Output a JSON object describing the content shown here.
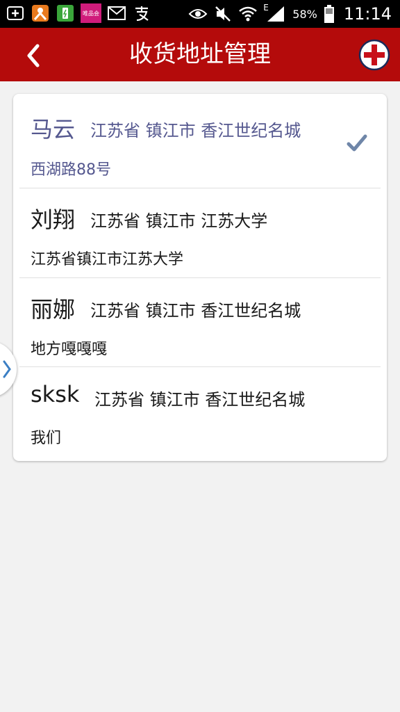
{
  "status_bar": {
    "battery_percent": "58%",
    "time": "11:14",
    "network_type": "E",
    "app_badge_text": "唯品会"
  },
  "header": {
    "title": "收货地址管理"
  },
  "addresses": [
    {
      "name": "马云",
      "region": "江苏省 镇江市 香江世纪名城",
      "detail": "西湖路88号",
      "selected": true
    },
    {
      "name": "刘翔",
      "region": "江苏省 镇江市 江苏大学",
      "detail": "江苏省镇江市江苏大学",
      "selected": false
    },
    {
      "name": "丽娜",
      "region": "江苏省 镇江市 香江世纪名城",
      "detail": "地方嘎嘎嘎",
      "selected": false
    },
    {
      "name": "sksk",
      "region": "江苏省 镇江市 香江世纪名城",
      "detail": "我们",
      "selected": false
    }
  ],
  "colors": {
    "header_bg": "#b40b0b",
    "selected_text": "#55588f",
    "check_color": "#6f86a8"
  }
}
